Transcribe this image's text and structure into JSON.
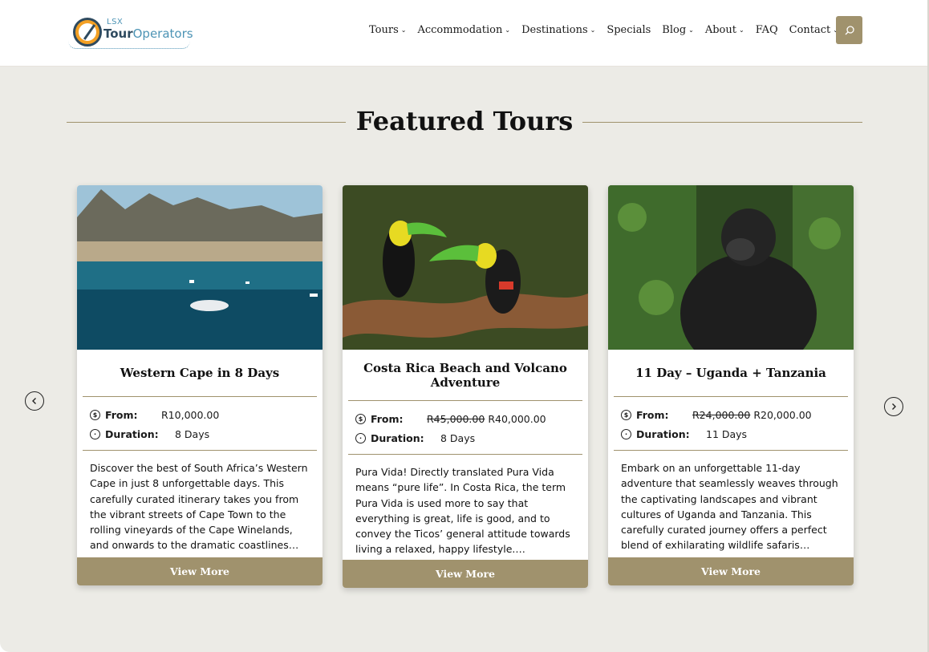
{
  "brand": {
    "logo_small": "LSX",
    "logo_word1": "Tour",
    "logo_word2": "Operators",
    "accent": "#a0926d",
    "background": "#ecebe6"
  },
  "nav": {
    "items": [
      {
        "label": "Tours",
        "has_dropdown": true
      },
      {
        "label": "Accommodation",
        "has_dropdown": true
      },
      {
        "label": "Destinations",
        "has_dropdown": true
      },
      {
        "label": "Specials",
        "has_dropdown": false
      },
      {
        "label": "Blog",
        "has_dropdown": true
      },
      {
        "label": "About",
        "has_dropdown": true
      },
      {
        "label": "FAQ",
        "has_dropdown": false
      },
      {
        "label": "Contact",
        "has_dropdown": true
      }
    ],
    "caret": "⌄",
    "search_icon": "search-icon"
  },
  "section": {
    "title": "Featured Tours"
  },
  "carousel": {
    "prev_icon": "chevron-left-icon",
    "next_icon": "chevron-right-icon"
  },
  "cards": [
    {
      "title": "Western Cape in 8 Days",
      "from_label": "From:",
      "price_old": "",
      "price": "R10,000.00",
      "duration_label": "Duration:",
      "duration": "8 Days",
      "description": "Discover the best of South Africa’s Western Cape in just 8 unforgettable days. This carefully curated itinerary takes you from the vibrant streets of Cape Town to the rolling vineyards of the Cape Winelands, and onwards to the dramatic coastlines…",
      "button": "View More"
    },
    {
      "title": "Costa Rica Beach and Volcano Adventure",
      "from_label": "From:",
      "price_old": "R45,000.00",
      "price": "R40,000.00",
      "duration_label": "Duration:",
      "duration": "8 Days",
      "description": "Pura Vida! Directly translated Pura Vida means “pure life”. In Costa Rica, the term Pura Vida is used more to say that everything is great, life is good, and to convey the Ticos’ general attitude towards living a relaxed, happy lifestyle.…",
      "button": "View More"
    },
    {
      "title": "11 Day – Uganda + Tanzania",
      "from_label": "From:",
      "price_old": "R24,000.00",
      "price": "R20,000.00",
      "duration_label": "Duration:",
      "duration": "11 Days",
      "description": "Embark on an unforgettable 11-day adventure that seamlessly weaves through the captivating landscapes and vibrant cultures of Uganda and Tanzania. This carefully curated journey offers a perfect blend of exhilarating wildlife safaris…",
      "button": "View More"
    }
  ]
}
